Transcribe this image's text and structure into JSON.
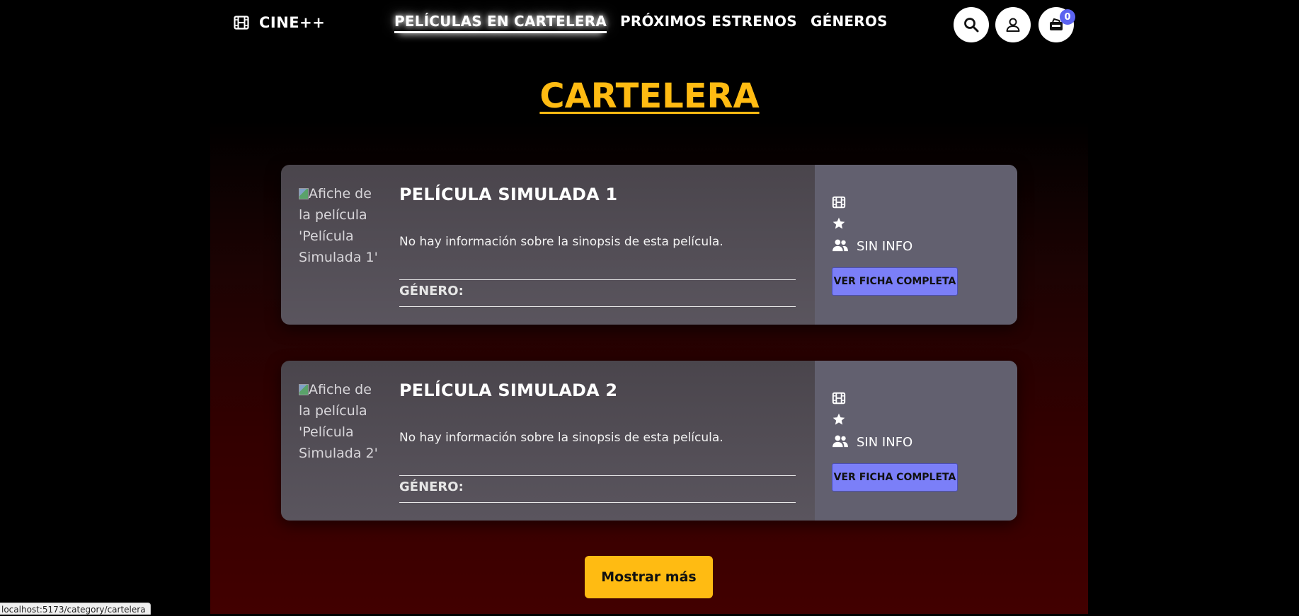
{
  "header": {
    "logo_text": "CINE++",
    "nav": [
      {
        "label": "PELÍCULAS EN CARTELERA",
        "active": true
      },
      {
        "label": "PRÓXIMOS ESTRENOS",
        "active": false
      },
      {
        "label": "GÉNEROS",
        "active": false
      }
    ],
    "cart_count": "0",
    "icons": [
      "film-icon",
      "search-icon",
      "user-icon",
      "cart-icon"
    ]
  },
  "main": {
    "title": "CARTELERA",
    "movies": [
      {
        "poster_alt": "Afiche de la película 'Película Simulada 1'",
        "title": "PELÍCULA SIMULADA 1",
        "synopsis": "No hay información sobre la sinopsis de esta película.",
        "genre_label": "GÉNERO:",
        "audience": "SIN INFO",
        "button_label": "VER FICHA COMPLETA"
      },
      {
        "poster_alt": "Afiche de la película 'Película Simulada 2'",
        "title": "PELÍCULA SIMULADA 2",
        "synopsis": "No hay información sobre la sinopsis de esta película.",
        "genre_label": "GÉNERO:",
        "audience": "SIN INFO",
        "button_label": "VER FICHA COMPLETA"
      }
    ],
    "more_button": "Mostrar más"
  },
  "status_url": "localhost:5173/category/cartelera",
  "colors": {
    "accent_yellow": "#ffbb12",
    "button_blue": "#7b7ff8",
    "badge_blue": "#5b63f0",
    "card_side": "#62606f"
  }
}
